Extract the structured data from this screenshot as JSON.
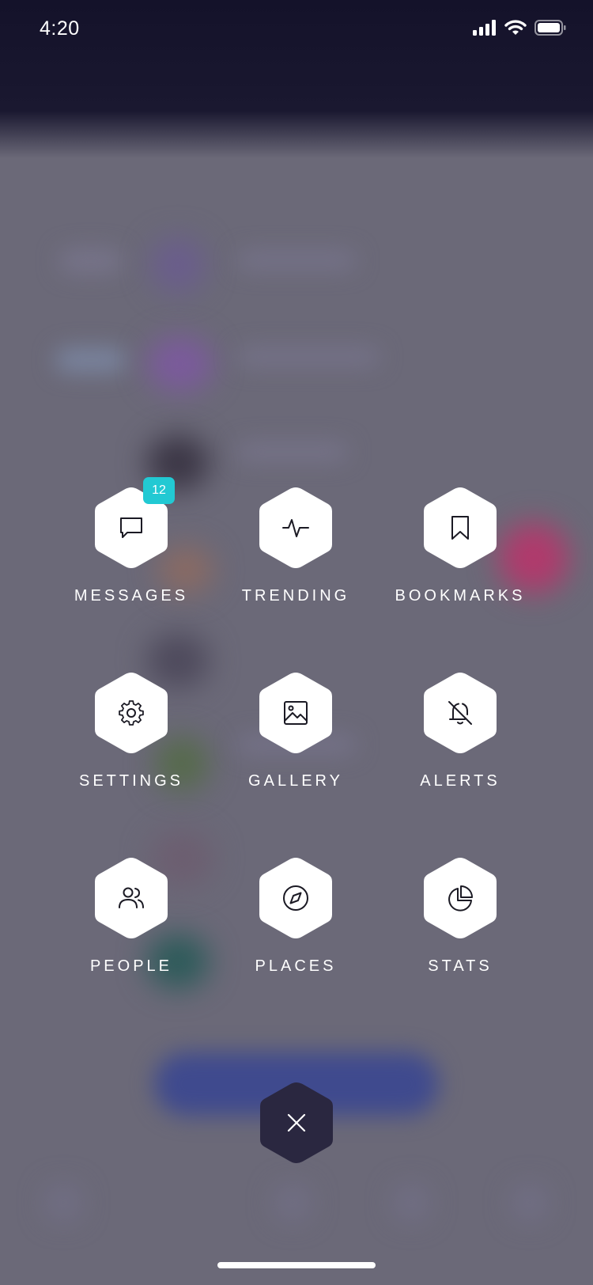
{
  "status_bar": {
    "time": "4:20"
  },
  "menu": {
    "messages": {
      "label": "MESSAGES",
      "badge": "12",
      "icon": "chat-bubble-icon"
    },
    "trending": {
      "label": "TRENDING",
      "icon": "activity-icon"
    },
    "bookmarks": {
      "label": "BOOKMARKS",
      "icon": "bookmark-icon"
    },
    "settings": {
      "label": "SETTINGS",
      "icon": "gear-icon"
    },
    "gallery": {
      "label": "GALLERY",
      "icon": "image-icon"
    },
    "alerts": {
      "label": "ALERTS",
      "icon": "bell-off-icon"
    },
    "people": {
      "label": "PEOPLE",
      "icon": "users-icon"
    },
    "places": {
      "label": "PLACES",
      "icon": "compass-icon"
    },
    "stats": {
      "label": "STATS",
      "icon": "pie-chart-icon"
    }
  },
  "close": {
    "icon": "close-icon"
  },
  "colors": {
    "accent_badge": "#22c9d3",
    "hex_tile": "#ffffff",
    "close_tile": "#2a2740",
    "overlay": "#6b6978"
  }
}
